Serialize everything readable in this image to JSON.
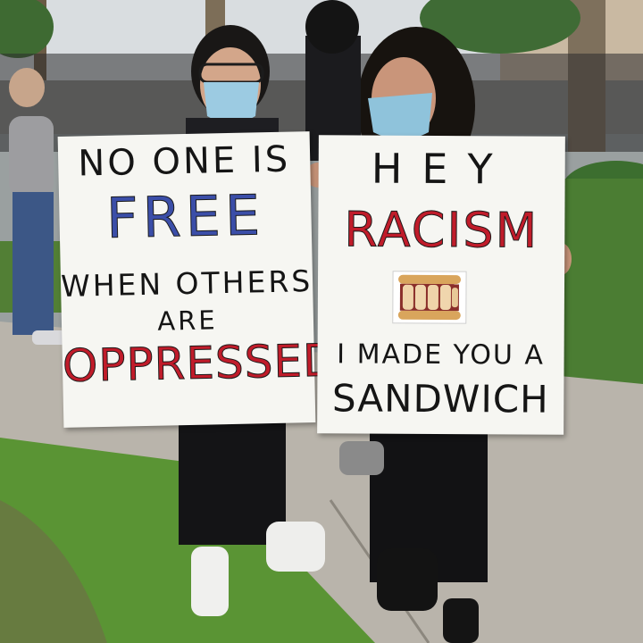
{
  "scene": {
    "description_colors": {
      "sky": "#d9dde0",
      "grass": "#4f8f2e",
      "sidewalk": "#b9b4ab",
      "sign": "#f6f6f2",
      "red_marker": "#c01c2a",
      "blue_marker": "#3b4ea8"
    }
  },
  "sign_left": {
    "line1": "NO ONE IS",
    "line2_word": "FREE",
    "line3": "WHEN OTHERS",
    "line4": "ARE",
    "line5_word": "OPPRESSED"
  },
  "sign_right": {
    "line1": "HEY",
    "line2_word": "RACISM",
    "line3": "I MADE YOU A",
    "line4": "SANDWICH"
  }
}
